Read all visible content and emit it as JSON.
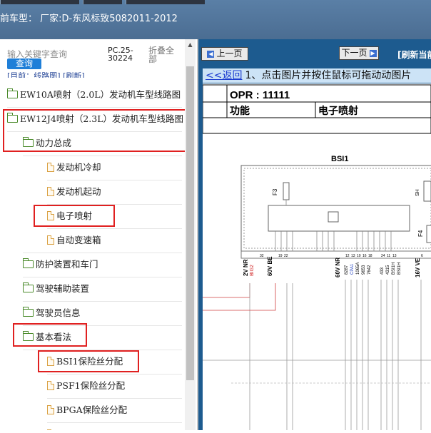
{
  "header": {
    "car_info": "前车型： 厂家:D-东风标致5082011-2012"
  },
  "left_panel": {
    "search_placeholder": "输入关键字查询",
    "search_button": "查询",
    "pc_code": "PC.25-30224",
    "collapse_all": "折叠全部",
    "breadcrumb": "[目前：线路图] [刷新]",
    "tree": [
      {
        "label": "EW10A喷射（2.0L）发动机车型线路图",
        "icon": "folder-icon"
      },
      {
        "label": "EW12J4喷射（2.3L）发动机车型线路图",
        "icon": "folder-open-icon"
      },
      {
        "label": "动力总成",
        "icon": "folder-open-icon"
      },
      {
        "label": "发动机冷却",
        "icon": "page-icon"
      },
      {
        "label": "发动机起动",
        "icon": "page-icon"
      },
      {
        "label": "电子喷射",
        "icon": "page-icon"
      },
      {
        "label": "自动变速箱",
        "icon": "page-icon"
      },
      {
        "label": "防护装置和车门",
        "icon": "folder-icon"
      },
      {
        "label": "驾驶辅助装置",
        "icon": "folder-icon"
      },
      {
        "label": "驾驶员信息",
        "icon": "folder-icon"
      },
      {
        "label": "基本看法",
        "icon": "folder-open-icon"
      },
      {
        "label": "BSI1保险丝分配",
        "icon": "page-icon"
      },
      {
        "label": "PSF1保险丝分配",
        "icon": "page-icon"
      },
      {
        "label": "BPGA保险丝分配",
        "icon": "page-icon"
      }
    ]
  },
  "right_panel": {
    "prev_button": "上一页",
    "next_button": "下一页",
    "refresh": "[刷新当前",
    "back_link": "<<返回",
    "instruction": "1、点击图片并按住鼠标可拖动动图片",
    "diagram": {
      "opr_label": "OPR : 11111",
      "function_label": "功能",
      "function_value": "电子喷射",
      "box_title": "BSI1",
      "fuse_labels": [
        "F3",
        "F4",
        "SH"
      ],
      "connector_labels": [
        "2V NR",
        "BIG2",
        "60V BE",
        "60V NR",
        "16V VE"
      ],
      "pin_labels": [
        "8287",
        "CPA1",
        "1065A",
        "9653",
        "7642",
        "433",
        "4315",
        "BSI1H",
        "BSI1H"
      ],
      "pin_numbers": [
        "32",
        "19",
        "22",
        "12",
        "13",
        "10",
        "16",
        "18",
        "24",
        "11",
        "13",
        "6"
      ]
    }
  },
  "colors": {
    "header_bg": "#4f739a",
    "panel_blue": "#1d5b8f",
    "highlight": "#e02020",
    "link": "#1a3ad0"
  }
}
